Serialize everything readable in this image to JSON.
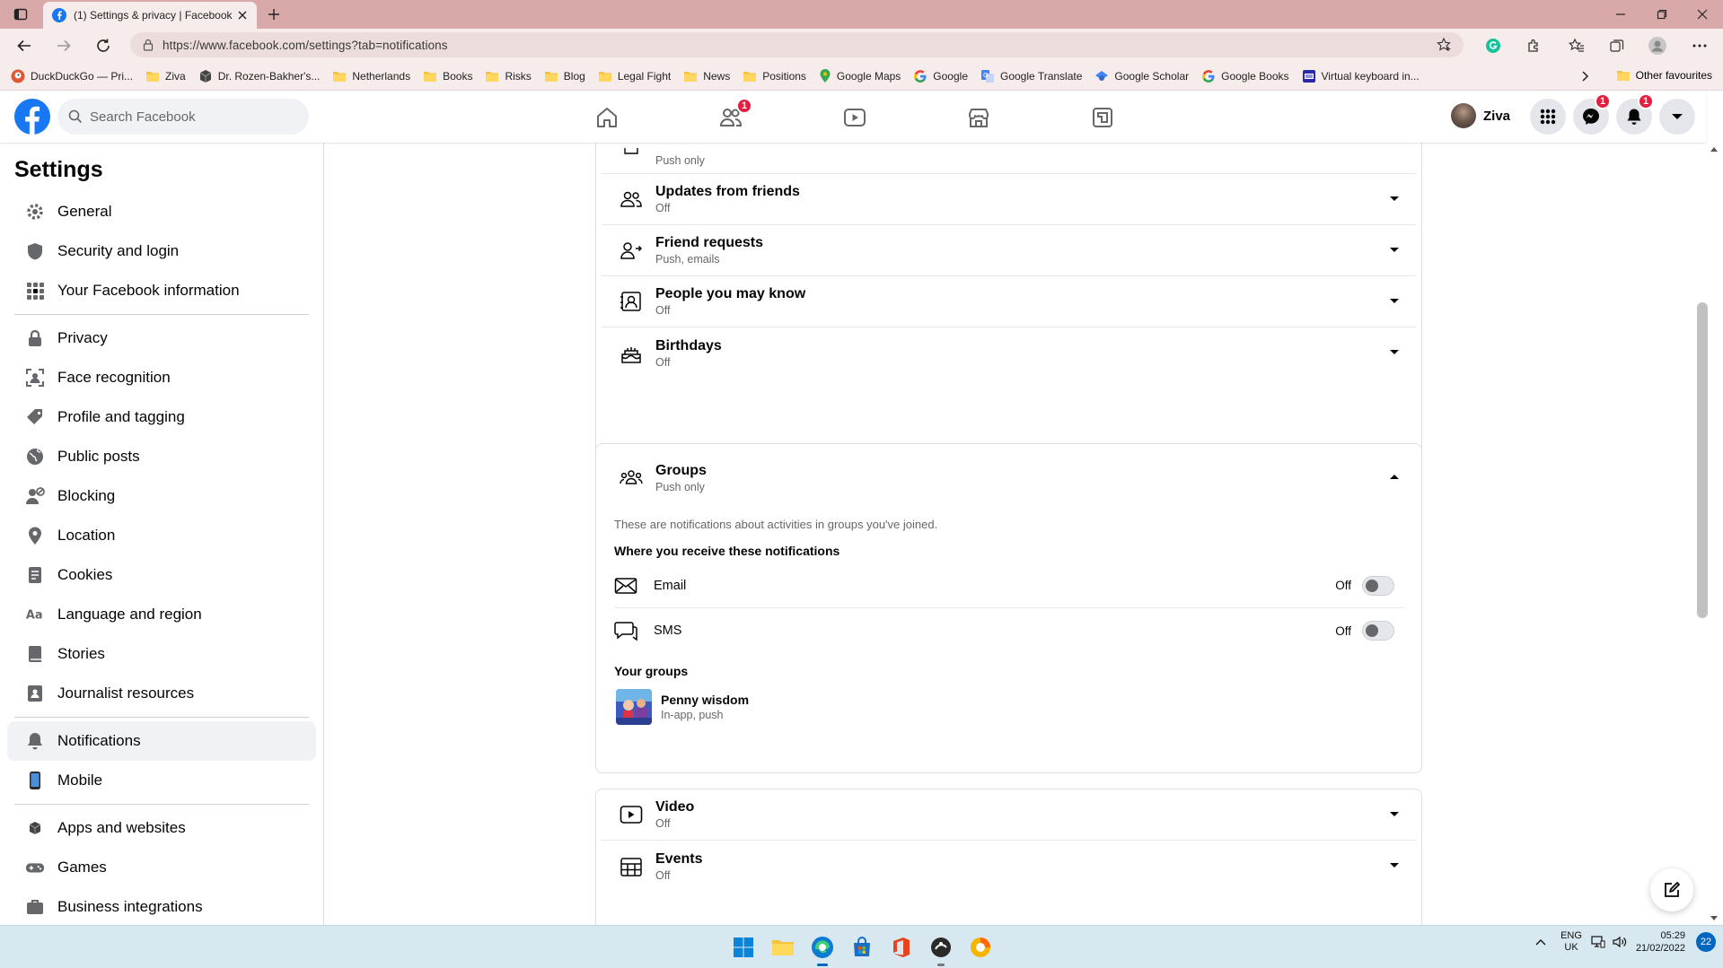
{
  "browser": {
    "tab_title": "(1) Settings & privacy | Facebook",
    "url": "https://www.facebook.com/settings?tab=notifications",
    "bookmarks": [
      {
        "label": "DuckDuckGo — Pri...",
        "icon": "duckduckgo-icon"
      },
      {
        "label": "Ziva",
        "icon": "folder-icon"
      },
      {
        "label": "Dr. Rozen-Bakher's...",
        "icon": "cube-icon"
      },
      {
        "label": "Netherlands",
        "icon": "folder-icon"
      },
      {
        "label": "Books",
        "icon": "folder-icon"
      },
      {
        "label": "Risks",
        "icon": "folder-icon"
      },
      {
        "label": "Blog",
        "icon": "folder-icon"
      },
      {
        "label": "Legal Fight",
        "icon": "folder-icon"
      },
      {
        "label": "News",
        "icon": "folder-icon"
      },
      {
        "label": "Positions",
        "icon": "folder-icon"
      },
      {
        "label": "Google Maps",
        "icon": "maps-icon"
      },
      {
        "label": "Google",
        "icon": "google-icon"
      },
      {
        "label": "Google Translate",
        "icon": "translate-icon"
      },
      {
        "label": "Google Scholar",
        "icon": "scholar-icon"
      },
      {
        "label": "Google Books",
        "icon": "google-icon"
      },
      {
        "label": "Virtual keyboard in...",
        "icon": "keyboard-icon"
      }
    ],
    "other_favourites": "Other favourites"
  },
  "header": {
    "search_placeholder": "Search Facebook",
    "friends_badge": "1",
    "profile_name": "Ziva",
    "messenger_badge": "1",
    "notifications_badge": "1"
  },
  "sidebar": {
    "title": "Settings",
    "groups": [
      [
        {
          "label": "General",
          "icon": "gear-icon"
        },
        {
          "label": "Security and login",
          "icon": "shield-icon"
        },
        {
          "label": "Your Facebook information",
          "icon": "grid-icon"
        }
      ],
      [
        {
          "label": "Privacy",
          "icon": "lock-icon"
        },
        {
          "label": "Face recognition",
          "icon": "face-scan-icon"
        },
        {
          "label": "Profile and tagging",
          "icon": "tag-icon"
        },
        {
          "label": "Public posts",
          "icon": "globe-icon"
        },
        {
          "label": "Blocking",
          "icon": "block-user-icon"
        },
        {
          "label": "Location",
          "icon": "location-pin-icon"
        },
        {
          "label": "Cookies",
          "icon": "cookie-icon"
        },
        {
          "label": "Language and region",
          "icon": "language-icon"
        },
        {
          "label": "Stories",
          "icon": "book-icon"
        },
        {
          "label": "Journalist resources",
          "icon": "id-badge-icon"
        }
      ],
      [
        {
          "label": "Notifications",
          "icon": "bell-icon",
          "active": true
        },
        {
          "label": "Mobile",
          "icon": "phone-icon"
        }
      ],
      [
        {
          "label": "Apps and websites",
          "icon": "cube-icon"
        },
        {
          "label": "Games",
          "icon": "gamepad-icon"
        },
        {
          "label": "Business integrations",
          "icon": "briefcase-icon"
        }
      ]
    ]
  },
  "main": {
    "top_row_subtitle": "Push only",
    "card1_rows": [
      {
        "title": "Updates from friends",
        "subtitle": "Off",
        "icon": "friends-icon"
      },
      {
        "title": "Friend requests",
        "subtitle": "Push, emails",
        "icon": "friend-request-icon"
      },
      {
        "title": "People you may know",
        "subtitle": "Off",
        "icon": "contact-card-icon"
      },
      {
        "title": "Birthdays",
        "subtitle": "Off",
        "icon": "cake-icon"
      }
    ],
    "groups": {
      "title": "Groups",
      "subtitle": "Push only",
      "description": "These are notifications about activities in groups you've joined.",
      "where_heading": "Where you receive these notifications",
      "channels": [
        {
          "label": "Email",
          "value": "Off",
          "icon": "envelope-icon"
        },
        {
          "label": "SMS",
          "value": "Off",
          "icon": "chat-bubble-icon"
        }
      ],
      "your_groups_heading": "Your groups",
      "group_name": "Penny wisdom",
      "group_status": "In-app, push"
    },
    "card3_rows": [
      {
        "title": "Video",
        "subtitle": "Off",
        "icon": "video-icon"
      },
      {
        "title": "Events",
        "subtitle": "Off",
        "icon": "calendar-icon"
      }
    ]
  },
  "taskbar": {
    "lang_top": "ENG",
    "lang_bottom": "UK",
    "time": "05:29",
    "date": "21/02/2022",
    "notification_count": "22"
  },
  "colors": {
    "brand": "#1877f2",
    "badge": "#e41e3f",
    "tabbar": "#d9a9a9"
  }
}
